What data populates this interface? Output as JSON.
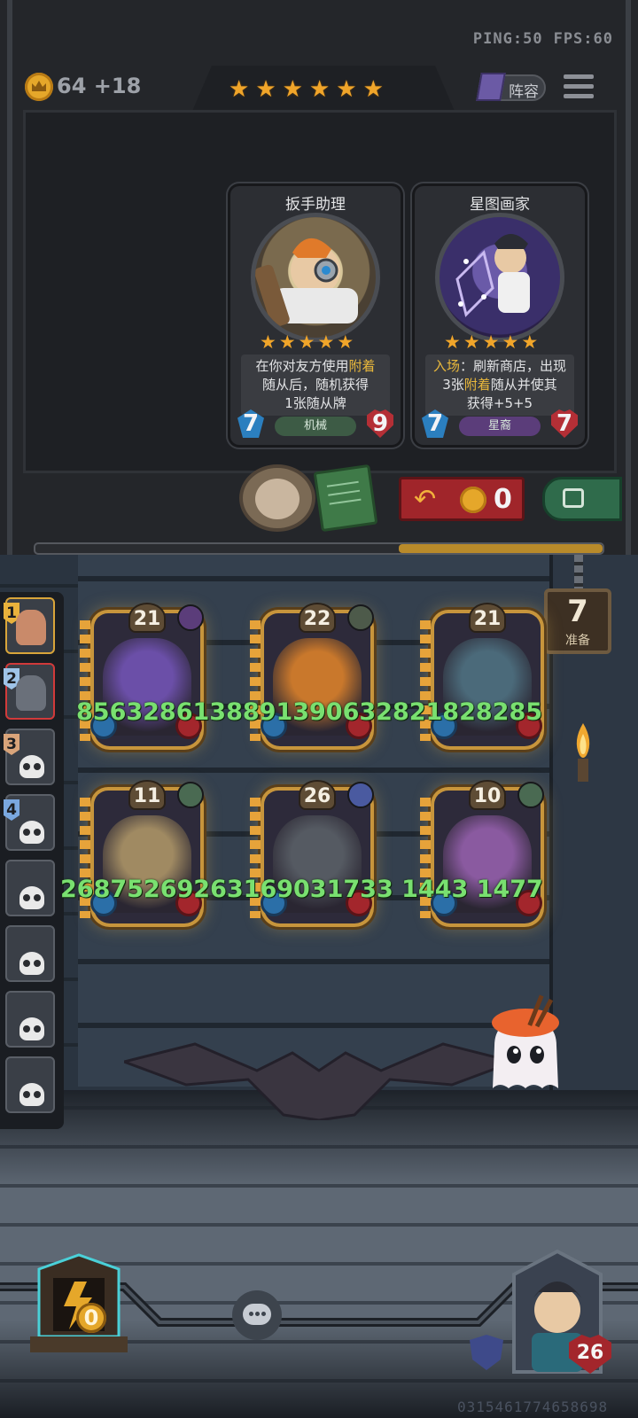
{
  "status": {
    "ping": "PING:50",
    "fps": "FPS:60"
  },
  "gold": {
    "value": "64 +18"
  },
  "tavern": {
    "star_count": 6
  },
  "lineup_button": {
    "label": "阵容"
  },
  "shop": {
    "cards": [
      {
        "name": "扳手助理",
        "stars": 5,
        "desc_lines": [
          [
            {
              "t": "在你对友方使用",
              "hl": false
            },
            {
              "t": "附着",
              "hl": true
            }
          ],
          [
            {
              "t": "随从后，随机获得",
              "hl": false
            }
          ],
          [
            {
              "t": "1张随从牌",
              "hl": false
            }
          ]
        ],
        "attack": "7",
        "health": "9",
        "tribe": "机械"
      },
      {
        "name": "星图画家",
        "stars": 5,
        "desc_lines": [
          [
            {
              "t": "入场",
              "hl": true
            },
            {
              "t": "：刷新商店，出现",
              "hl": false
            }
          ],
          [
            {
              "t": "3张",
              "hl": false
            },
            {
              "t": "附着",
              "hl": true
            },
            {
              "t": "随从并使其",
              "hl": false
            }
          ],
          [
            {
              "t": "获得+5+5",
              "hl": false
            }
          ]
        ],
        "attack": "7",
        "health": "7",
        "tribe": "星裔"
      }
    ],
    "refresh_cost": "0"
  },
  "ready": {
    "count": "7",
    "label": "准备"
  },
  "players": [
    {
      "rank": "1",
      "rank_color": "#e9b23c",
      "alive": true
    },
    {
      "rank": "2",
      "rank_color": "#9fc4e8",
      "alive": true
    },
    {
      "rank": "3",
      "rank_color": "#d9a47a",
      "alive": false
    },
    {
      "rank": "4",
      "rank_color": "#7aa8e0",
      "alive": false
    },
    {
      "rank": "",
      "alive": false
    },
    {
      "rank": "",
      "alive": false
    },
    {
      "rank": "",
      "alive": false
    },
    {
      "rank": "",
      "alive": false
    }
  ],
  "board": {
    "minions": [
      {
        "level": "21",
        "tribe_color": "#5b3d7a",
        "art": "#6b4fa8"
      },
      {
        "level": "22",
        "tribe_color": "#4d5a4a",
        "art": "#c9782c"
      },
      {
        "level": "21",
        "tribe_color": "",
        "art": "#4b6a7a"
      },
      {
        "level": "11",
        "tribe_color": "#4a6a52",
        "art": "#a08a62"
      },
      {
        "level": "26",
        "tribe_color": "#4a5aa0",
        "art": "#555a62"
      },
      {
        "level": "10",
        "tribe_color": "#4a6a52",
        "art": "#8a5aa0"
      }
    ],
    "overlay_row1": "8563286138891390632821828285",
    "overlay_row2": "26875269263169031733  1443  1477"
  },
  "bottom": {
    "energy": "0",
    "hero_health": "26",
    "uid": "0315461774658698"
  },
  "colors": {
    "gold": "#e5a72a",
    "star": "#f0a52a",
    "refresh_red": "#a0252a",
    "freeze_green": "#2f6b4b",
    "overlay_green": "#79e070"
  }
}
